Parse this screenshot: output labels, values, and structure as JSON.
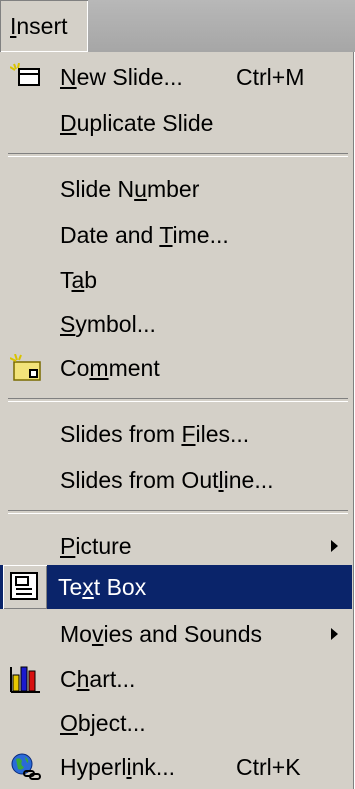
{
  "menu": {
    "title_pre": "",
    "title_u": "I",
    "title_post": "nsert"
  },
  "items": [
    {
      "pre": "",
      "u": "N",
      "post": "ew Slide...",
      "shortcut": "Ctrl+M",
      "icon": "new-slide-icon"
    },
    {
      "pre": "",
      "u": "D",
      "post": "uplicate Slide"
    },
    {
      "pre": "Slide N",
      "u": "u",
      "post": "mber"
    },
    {
      "pre": "Date and ",
      "u": "T",
      "post": "ime..."
    },
    {
      "pre": "T",
      "u": "a",
      "post": "b"
    },
    {
      "pre": "",
      "u": "S",
      "post": "ymbol..."
    },
    {
      "pre": "Co",
      "u": "m",
      "post": "ment",
      "icon": "comment-icon"
    },
    {
      "pre": "Slides from ",
      "u": "F",
      "post": "iles..."
    },
    {
      "pre": "Slides from Out",
      "u": "l",
      "post": "ine..."
    },
    {
      "pre": "",
      "u": "P",
      "post": "icture",
      "submenu": true
    },
    {
      "pre": "Te",
      "u": "x",
      "post": "t Box",
      "icon": "text-box-icon",
      "selected": true
    },
    {
      "pre": "Mo",
      "u": "v",
      "post": "ies and Sounds",
      "submenu": true
    },
    {
      "pre": "C",
      "u": "h",
      "post": "art...",
      "icon": "chart-icon"
    },
    {
      "pre": "",
      "u": "O",
      "post": "bject..."
    },
    {
      "pre": "Hyperl",
      "u": "i",
      "post": "nk...",
      "shortcut": "Ctrl+K",
      "icon": "hyperlink-icon"
    }
  ],
  "colors": {
    "menu_bg": "#d4d0c8",
    "highlight_bg": "#0a246a",
    "highlight_text": "#ffffff",
    "bar_bg": "#a6a6a6"
  }
}
